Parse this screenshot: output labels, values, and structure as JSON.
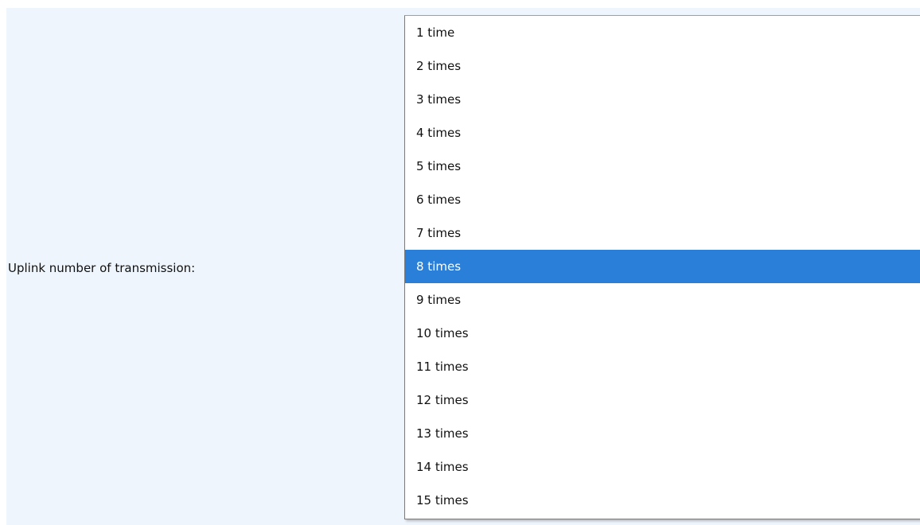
{
  "form": {
    "label": "Uplink number of transmission:"
  },
  "dropdown": {
    "selected_index": 7,
    "selected_color": "#2a7fd8",
    "options": [
      "1 time",
      "2 times",
      "3 times",
      "4 times",
      "5 times",
      "6 times",
      "7 times",
      "8 times",
      "9 times",
      "10 times",
      "11 times",
      "12 times",
      "13 times",
      "14 times",
      "15 times"
    ]
  }
}
